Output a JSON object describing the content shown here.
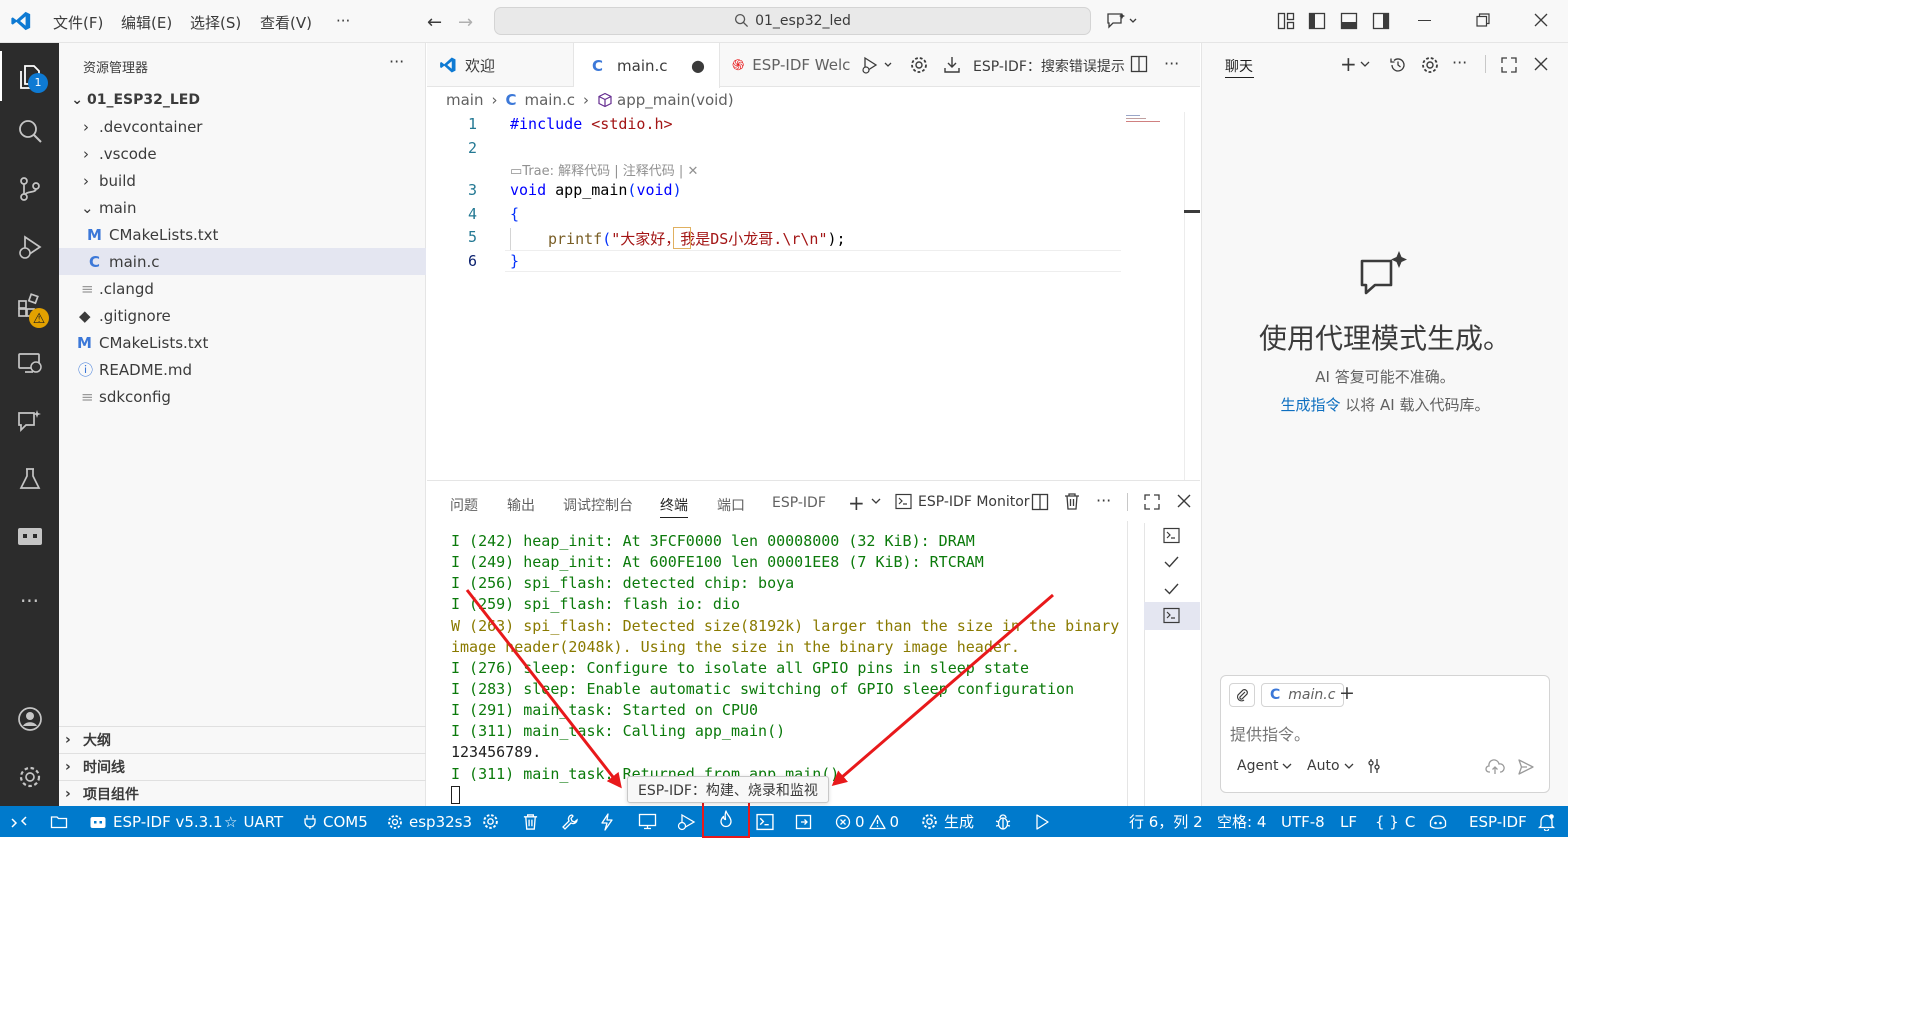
{
  "titlebar": {
    "menus": [
      "文件(F)",
      "编辑(E)",
      "选择(S)",
      "查看(V)",
      "···"
    ],
    "search_text": "01_esp32_led"
  },
  "activity": {
    "explorer_badge": "1"
  },
  "explorer": {
    "title": "资源管理器",
    "more": "···",
    "root": "01_ESP32_LED",
    "items": [
      {
        "label": ".devcontainer",
        "icon": "chevron-right-icon"
      },
      {
        "label": ".vscode",
        "icon": "chevron-right-icon"
      },
      {
        "label": "build",
        "icon": "chevron-right-icon"
      },
      {
        "label": "main",
        "icon": "chevron-down-icon"
      },
      {
        "label": "CMakeLists.txt",
        "icon": "cmake-file-icon"
      },
      {
        "label": "main.c",
        "icon": "c-file-icon"
      },
      {
        "label": ".clangd",
        "icon": "text-file-icon"
      },
      {
        "label": ".gitignore",
        "icon": "git-file-icon"
      },
      {
        "label": "CMakeLists.txt",
        "icon": "cmake-file-icon"
      },
      {
        "label": "README.md",
        "icon": "info-file-icon"
      },
      {
        "label": "sdkconfig",
        "icon": "text-file-icon"
      }
    ],
    "sections": [
      "大纲",
      "时间线",
      "项目组件"
    ]
  },
  "editor": {
    "tabs": [
      "欢迎",
      "main.c",
      "ESP-IDF Welc"
    ],
    "toolbar_label": "ESP-IDF：搜索错误提示",
    "breadcrumb": [
      "main",
      "main.c",
      "app_main(void)"
    ],
    "codelens": "Trae: 解释代码 | 注释代码 | ✕",
    "lines": [
      "1",
      "2",
      "3",
      "4",
      "5",
      "6"
    ],
    "code": {
      "l1_kw": "#include ",
      "l1_str": "<stdio.h>",
      "l3_type": "void ",
      "l3_fn": "app_main",
      "l3_open": "(",
      "l3_arg": "void",
      "l3_close": ")",
      "l4": "{",
      "l5_fn": "printf",
      "l5_p": "(",
      "l5_str": "\"大家好，我是DS小龙哥.\\r\\n\"",
      "l5_end": ");",
      "l6": "}"
    }
  },
  "panel": {
    "tabs": [
      "问题",
      "输出",
      "调试控制台",
      "终端",
      "端口",
      "ESP-IDF"
    ],
    "active_tab": "终端",
    "monitor_label": "ESP-IDF Monitor",
    "terminal": [
      {
        "text": "I (242) heap_init: At 3FCF0000 len 00008000 (32 KiB): DRAM",
        "color": "#0b7a0b"
      },
      {
        "text": "I (249) heap_init: At 600FE100 len 00001EE8 (7 KiB): RTCRAM",
        "color": "#0b7a0b"
      },
      {
        "text": "I (256) spi_flash: detected chip: boya",
        "color": "#0b7a0b"
      },
      {
        "text": "I (259) spi_flash: flash io: dio",
        "color": "#0b7a0b"
      },
      {
        "text": "W (263) spi_flash: Detected size(8192k) larger than the size in the binary",
        "color": "#8a7a00"
      },
      {
        "text": "image header(2048k). Using the size in the binary image header.",
        "color": "#8a7a00"
      },
      {
        "text": "I (276) sleep: Configure to isolate all GPIO pins in sleep state",
        "color": "#0b7a0b"
      },
      {
        "text": "I (283) sleep: Enable automatic switching of GPIO sleep configuration",
        "color": "#0b7a0b"
      },
      {
        "text": "I (291) main_task: Started on CPU0",
        "color": "#0b7a0b"
      },
      {
        "text": "I (311) main_task: Calling app_main()",
        "color": "#0b7a0b"
      },
      {
        "text": "123456789.",
        "color": "#1f1f1f"
      },
      {
        "text": "I (311) main_task: Returned from app_main()",
        "color": "#0b7a0b"
      }
    ]
  },
  "chat": {
    "title": "聊天",
    "heading": "使用代理模式生成。",
    "note": "AI 答复可能不准确。",
    "link": "生成指令",
    "link_suffix": " 以将 AI 载入代码库。",
    "context_file": "main.c",
    "input_placeholder": "提供指令。",
    "mode": "Agent",
    "model": "Auto"
  },
  "statusbar": {
    "idf_version": "ESP-IDF v5.3.1",
    "uart": "UART",
    "port": "COM5",
    "target": "esp32s3",
    "errors": "0",
    "warnings": "0",
    "build": "生成",
    "cursor": "行 6，列 2",
    "spaces": "空格: 4",
    "encoding": "UTF-8",
    "eol": "LF",
    "language": "C",
    "idf": "ESP-IDF"
  },
  "tooltip": "ESP-IDF：构建、烧录和监视",
  "colors": {
    "accent": "#007acc",
    "annotation": "#e8191b"
  }
}
